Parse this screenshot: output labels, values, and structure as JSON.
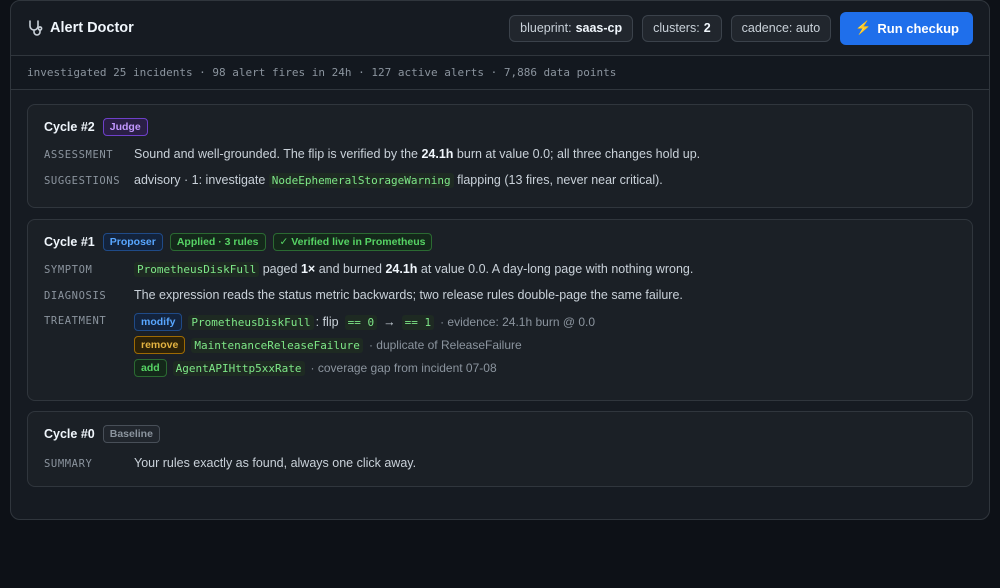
{
  "header": {
    "title": "Alert Doctor",
    "icon": "stethoscope-icon",
    "blueprint_label": "blueprint:",
    "blueprint_value": "saas-cp",
    "clusters_label": "clusters:",
    "clusters_value": "2",
    "cadence_label": "cadence: auto",
    "run_label": "Run checkup",
    "run_icon": "lightning-icon"
  },
  "stats": "investigated 25 incidents · 98 alert fires in 24h · 127 active alerts · 7,886 data points",
  "cycles": [
    {
      "title": "Cycle #2",
      "badges": [
        "Judge"
      ],
      "assessment_label": "ASSESSMENT",
      "assessment_pre": "Sound and well-grounded. The flip is verified by the",
      "assessment_bold": "24.1h",
      "assessment_post": "burn at value 0.0; all three changes hold up.",
      "suggestions_label": "SUGGESTIONS",
      "suggestions_pre": "advisory · 1: investigate",
      "suggestions_code": "NodeEphemeralStorageWarning",
      "suggestions_post": "flapping (13 fires, never near critical)."
    },
    {
      "title": "Cycle #1",
      "badges": [
        "Proposer",
        "Applied · 3 rules",
        "✓ Verified live in Prometheus"
      ],
      "symptom_label": "SYMPTOM",
      "symptom_code": "PrometheusDiskFull",
      "symptom_t1": "paged",
      "symptom_b1": "1×",
      "symptom_t2": "and burned",
      "symptom_b2": "24.1h",
      "symptom_t3": "at value 0.0. A day-long page with nothing wrong.",
      "diagnosis_label": "DIAGNOSIS",
      "diagnosis_text": "The expression reads the status metric backwards; two release rules double-page the same failure.",
      "treatment_label": "TREATMENT",
      "treatments": [
        {
          "action": "modify",
          "rule": "PrometheusDiskFull",
          "mid": ": flip",
          "from": "== 0",
          "arrow": "→",
          "to": "== 1",
          "note": "· evidence: 24.1h burn @ 0.0"
        },
        {
          "action": "remove",
          "rule": "MaintenanceReleaseFailure",
          "note": "· duplicate of ReleaseFailure"
        },
        {
          "action": "add",
          "rule": "AgentAPIHttp5xxRate",
          "note": "· coverage gap from incident 07-08"
        }
      ]
    },
    {
      "title": "Cycle #0",
      "badges": [
        "Baseline"
      ],
      "summary_label": "SUMMARY",
      "summary_text": "Your rules exactly as found, always one click away."
    }
  ],
  "colors": {
    "accent": "#1f6feb",
    "background": "#0d1117",
    "panel": "#161b22",
    "code_green": "#7ee787"
  }
}
